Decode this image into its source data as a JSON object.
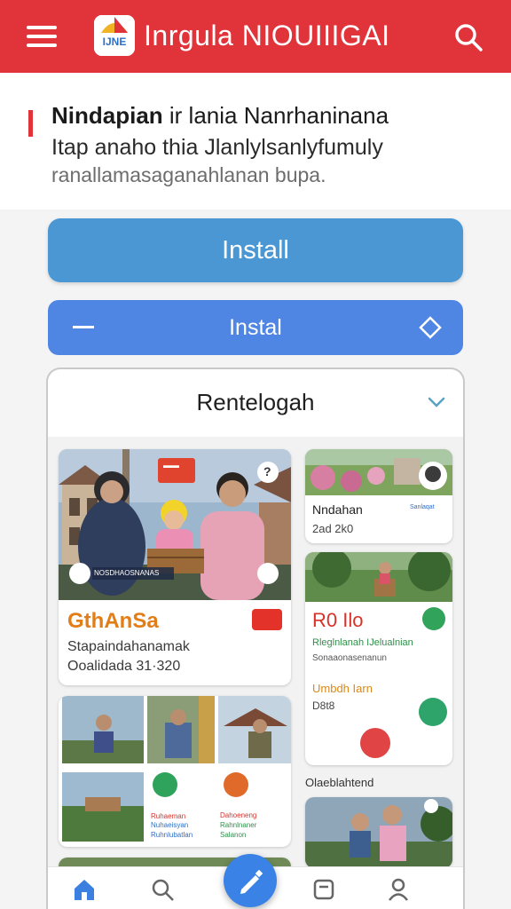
{
  "appbar": {
    "logo_text": "IJNE",
    "title": "Inrgula NIOUIIIGAI"
  },
  "intro": {
    "line1_bold": "Nindapian",
    "line1_rest": " ir lania Nanrhaninana",
    "line2": "Itap anaho thia Jlanlylsanlyfumuly",
    "line3": "ranallamasaganahlanan bupa."
  },
  "buttons": {
    "install": "Install",
    "instal": "Instal"
  },
  "card": {
    "title": "Rentelogah"
  },
  "tiles": {
    "main": {
      "sign_text": "▬▬",
      "banner": "NOSDHAOSNANAS",
      "heading": "GthAnSa",
      "line1": "Stapaindahanamak",
      "line2": "Ooalidada 31·320",
      "question": "?"
    },
    "right1": {
      "title": "Nndahan",
      "meta": "2ad 2k0",
      "caption": "Sanlaqat"
    },
    "right2": {
      "title": "R0 Ilo",
      "line1": "Rleglnlanah IJelualnian",
      "line2": "Sonaaonasenanun",
      "label": "Umbdh Iarn",
      "meta": "D8t8"
    },
    "grid": {
      "t1": "Ruhaeman",
      "t2": "Nuhaeisyan",
      "t3": "Ruhnlubatlan",
      "t4": "Dahoeneng",
      "t5": "Rahnlnaner",
      "t6": "Salanon"
    },
    "label_below": "Olaeblahtend"
  },
  "colors": {
    "appbar": "#e0343a",
    "install": "#4a97d4",
    "instal": "#4f86e3",
    "fab": "#3b82e6"
  },
  "icons": {
    "menu": "hamburger-icon",
    "search": "search-icon",
    "chevron": "chevron-down-icon",
    "diamond": "diamond-icon",
    "home": "home-icon",
    "explore": "search-icon",
    "compose": "pencil-icon",
    "inbox": "inbox-icon",
    "profile": "profile-icon"
  }
}
